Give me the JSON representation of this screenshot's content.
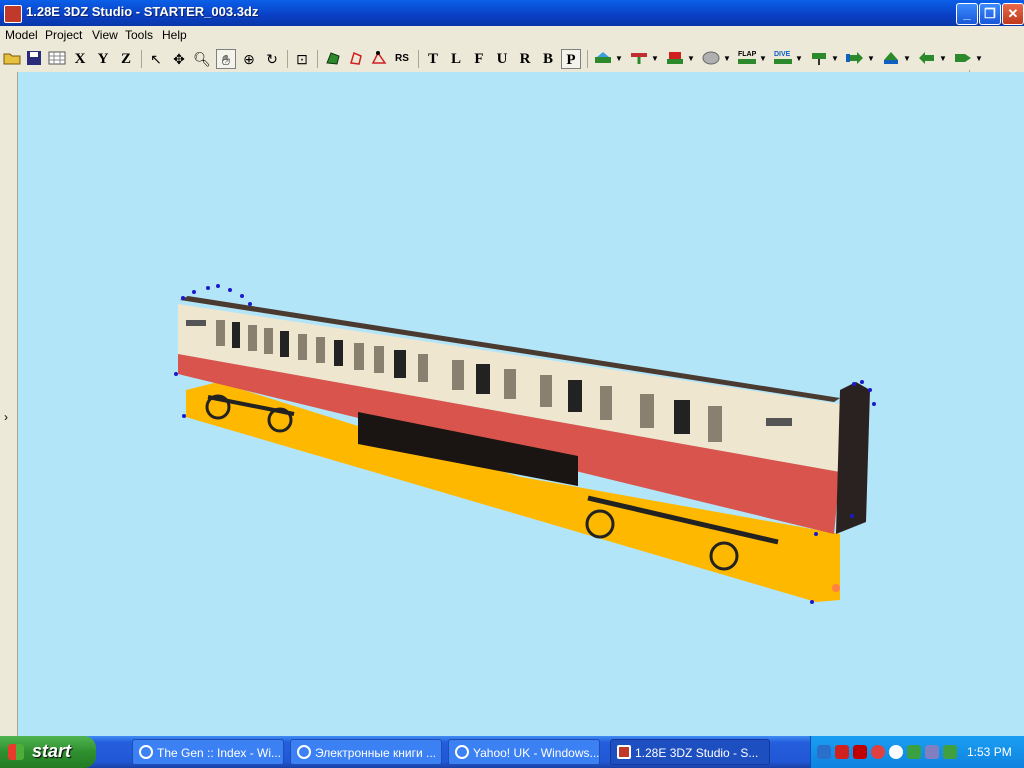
{
  "window": {
    "title": "1.28E 3DZ Studio - STARTER_003.3dz",
    "minimize": "_",
    "restore": "❐",
    "close": "✕"
  },
  "menu": [
    "Model",
    "Project",
    "View",
    "Tools",
    "Help"
  ],
  "toolbar": {
    "axis_x": "X",
    "axis_y": "Y",
    "axis_z": "Z",
    "rs": "RS",
    "view_letters": [
      "T",
      "L",
      "F",
      "U",
      "R",
      "B",
      "P"
    ],
    "flap": "FLAP",
    "dive": "DIVE"
  },
  "left_strip": {
    "expand": "›"
  },
  "taskbar": {
    "start": "start",
    "tasks": [
      "The Gen :: Index - Wi...",
      "Электронные книги ...",
      "Yahoo! UK - Windows...",
      "1.28E 3DZ Studio - S..."
    ],
    "clock": "1:53 PM"
  },
  "colors": {
    "viewport_bg": "#b3e5f8",
    "ground_plane": "#ffb800",
    "coach_upper": "#efe6cf",
    "coach_lower": "#d8544c",
    "vertex": "#1a1acc",
    "selected_vertex": "#ff8040"
  }
}
